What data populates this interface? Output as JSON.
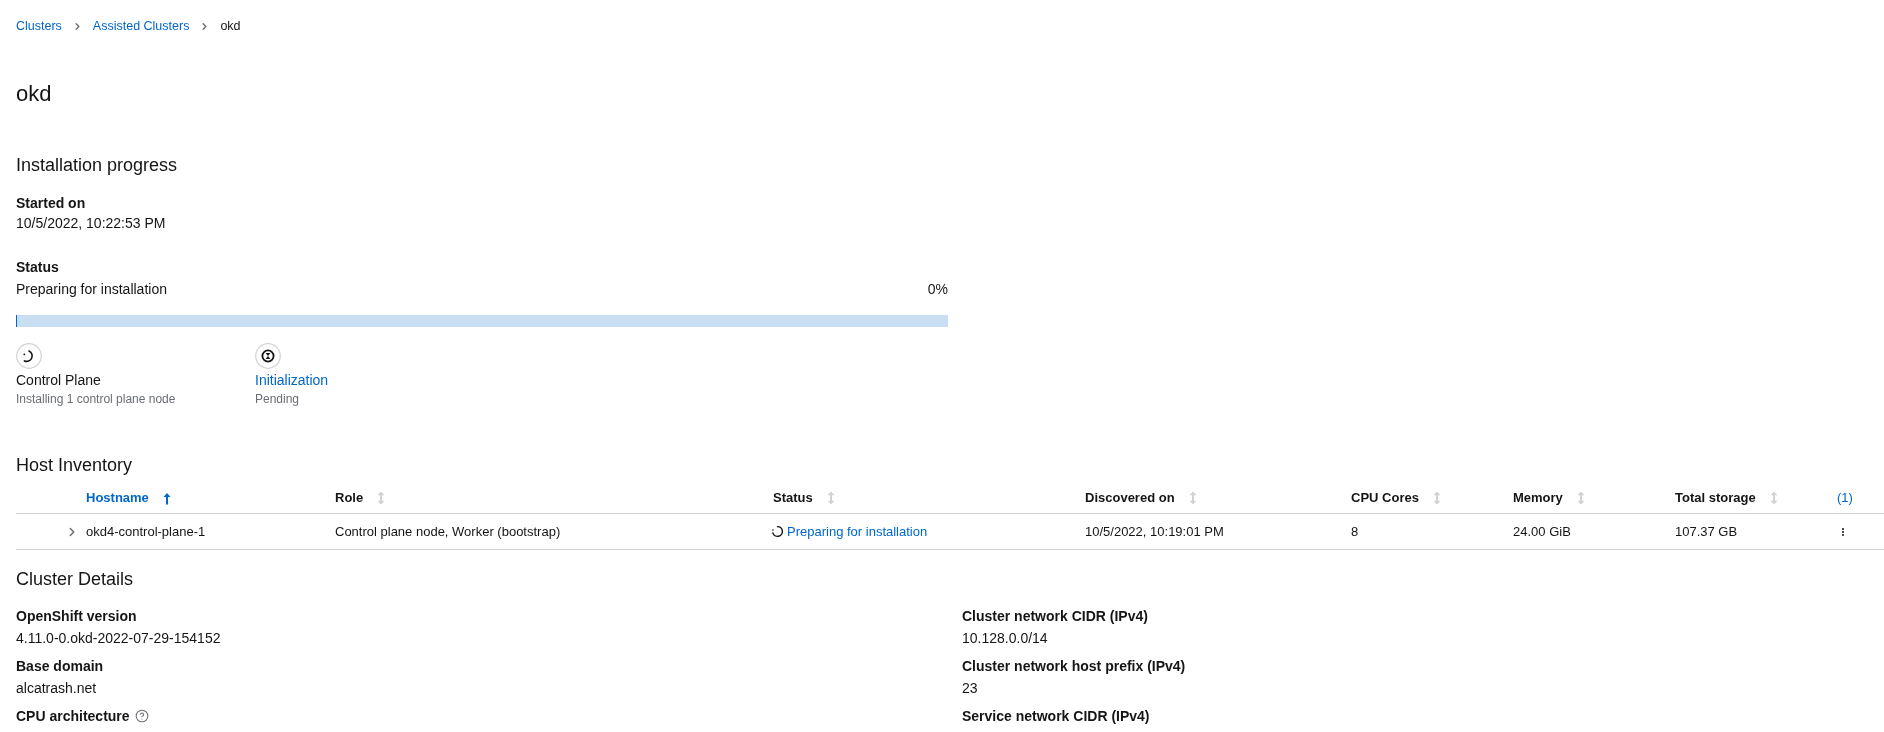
{
  "breadcrumb": [
    {
      "label": "Clusters",
      "kind": "link"
    },
    {
      "label": "Assisted Clusters",
      "kind": "link"
    },
    {
      "label": "okd",
      "kind": "current"
    }
  ],
  "page_title": "okd",
  "installation_progress": {
    "heading": "Installation progress",
    "started_on": {
      "label": "Started on",
      "value": "10/5/2022, 10:22:53 PM"
    },
    "status": {
      "label": "Status",
      "value": "Preparing for installation",
      "percent": "0%",
      "level": 0
    },
    "steps": [
      {
        "kind": "in_progress",
        "title": "Control Plane",
        "subtitle": "Installing 1 control plane node",
        "link": false
      },
      {
        "kind": "pending",
        "title": "Initialization",
        "subtitle": "Pending",
        "link": true
      }
    ]
  },
  "host_inventory": {
    "heading": "Host Inventory",
    "columns": [
      {
        "label": "Hostname",
        "sorted": true
      },
      {
        "label": "Role",
        "sorted": false
      },
      {
        "label": "Status",
        "sorted": false
      },
      {
        "label": "Discovered on",
        "sorted": false
      },
      {
        "label": "CPU Cores",
        "sorted": false
      },
      {
        "label": "Memory",
        "sorted": false
      },
      {
        "label": "Total storage",
        "sorted": false
      }
    ],
    "column_8_header": "(1)",
    "rows": [
      {
        "expanded": false,
        "cells": [
          {
            "kind": "text",
            "text": "okd4-control-plane-1"
          },
          {
            "kind": "text",
            "text": "Control plane node, Worker (bootstrap)"
          },
          {
            "kind": "status_link",
            "text": "Preparing for installation"
          },
          {
            "kind": "text",
            "text": "10/5/2022, 10:19:01 PM"
          },
          {
            "kind": "text",
            "text": "8"
          },
          {
            "kind": "text",
            "text": "24.00 GiB"
          },
          {
            "kind": "text",
            "text": "107.37 GB"
          }
        ]
      }
    ]
  },
  "cluster_details": {
    "heading": "Cluster Details",
    "left": [
      {
        "label": "OpenShift version",
        "value": "4.11.0-0.okd-2022-07-29-154152",
        "help": false
      },
      {
        "label": "Base domain",
        "value": "alcatrash.net",
        "help": false
      },
      {
        "label": "CPU architecture",
        "help": true
      }
    ],
    "right": [
      {
        "label": "Cluster network CIDR (IPv4)",
        "value": "10.128.0.0/14",
        "help": false
      },
      {
        "label": "Cluster network host prefix (IPv4)",
        "value": "23",
        "help": false
      },
      {
        "label": "Service network CIDR (IPv4)",
        "help": false
      }
    ]
  }
}
